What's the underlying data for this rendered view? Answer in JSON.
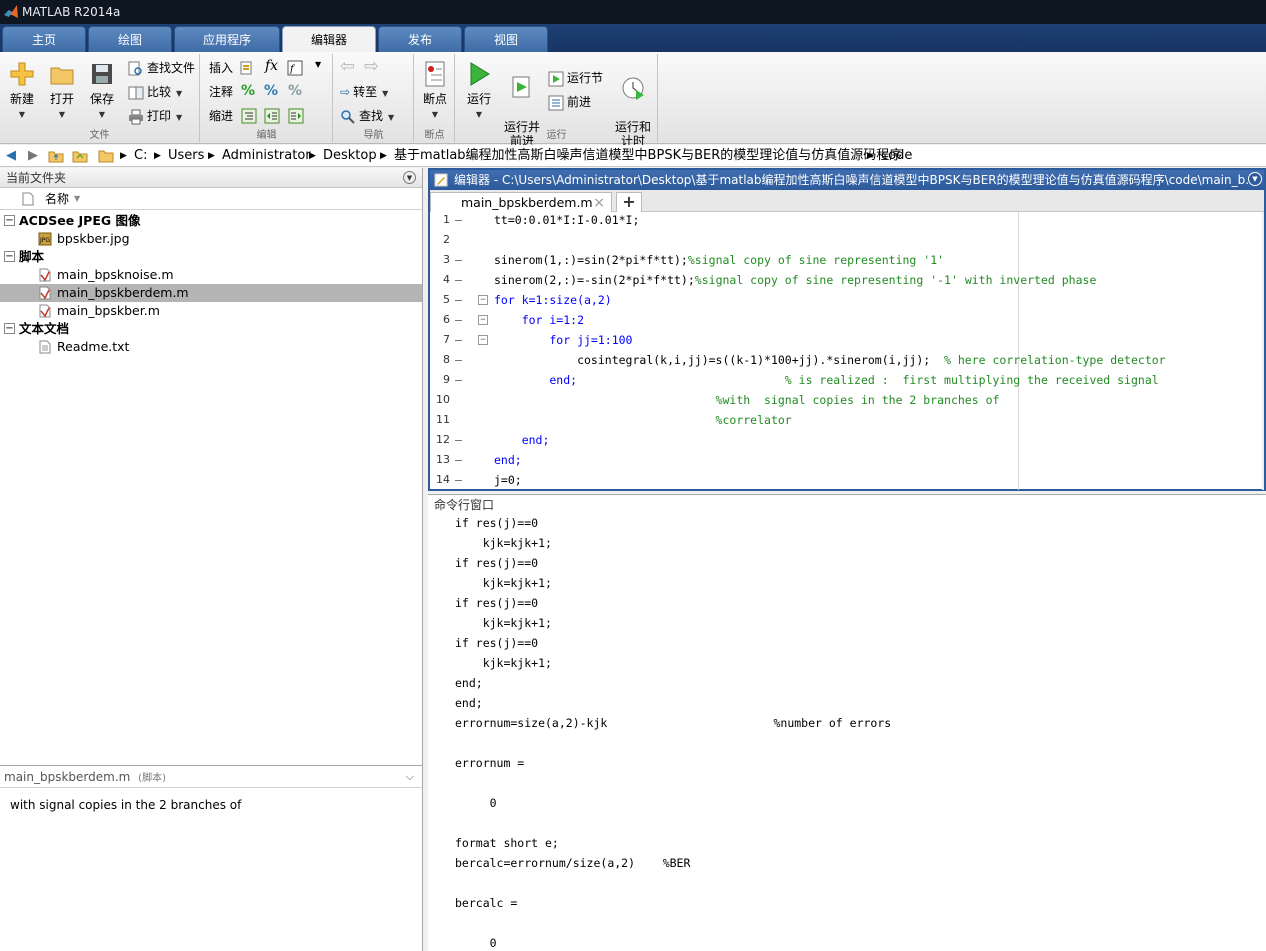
{
  "window": {
    "title": "MATLAB R2014a"
  },
  "tabs": [
    {
      "label": "主页"
    },
    {
      "label": "绘图"
    },
    {
      "label": "应用程序"
    },
    {
      "label": "编辑器"
    },
    {
      "label": "发布"
    },
    {
      "label": "视图"
    }
  ],
  "ribbon": {
    "file": {
      "group_label": "文件",
      "new_label": "新建",
      "open_label": "打开",
      "save_label": "保存",
      "find_files_label": "查找文件",
      "compare_label": "比较",
      "print_label": "打印"
    },
    "edit": {
      "group_label": "编辑",
      "insert_label": "插入",
      "comment_label": "注释",
      "indent_label": "缩进"
    },
    "navigate": {
      "group_label": "导航",
      "goto_label": "转至",
      "find_label": "查找"
    },
    "breakpoints": {
      "group_label": "断点",
      "breakpoints_label": "断点"
    },
    "run": {
      "group_label": "运行",
      "run_label": "运行",
      "run_advance_label": "运行并\n前进",
      "run_section_label": "运行节",
      "advance_label": "前进",
      "run_time_label": "运行和\n计时"
    }
  },
  "address": {
    "crumbs": [
      "C:",
      "Users",
      "Administrator",
      "Desktop",
      "基于matlab编程加性高斯白噪声信道模型中BPSK与BER的模型理论值与仿真值源码程序",
      "code"
    ]
  },
  "current_folder": {
    "title": "当前文件夹",
    "name_column": "名称",
    "groups": [
      {
        "label": "ACDSee JPEG 图像",
        "items": [
          "bpskber.jpg"
        ]
      },
      {
        "label": "脚本",
        "items": [
          "main_bpsknoise.m",
          "main_bpskberdem.m",
          "main_bpskber.m"
        ]
      },
      {
        "label": "文本文档",
        "items": [
          "Readme.txt"
        ]
      }
    ],
    "selected": "main_bpskberdem.m"
  },
  "details": {
    "file_name": "main_bpskberdem.m",
    "file_type": "(脚本)",
    "description": "with  signal copies in the 2 branches of"
  },
  "editor": {
    "title": "编辑器 - C:\\Users\\Administrator\\Desktop\\基于matlab编程加性高斯白噪声信道模型中BPSK与BER的模型理论值与仿真值源码程序\\code\\main_b...",
    "tab_label": "main_bpskberdem.m",
    "lines": [
      {
        "n": "1",
        "dash": "–",
        "code": "tt=0:0.01*I:I-0.01*I;"
      },
      {
        "n": "2",
        "dash": "",
        "code": ""
      },
      {
        "n": "3",
        "dash": "–",
        "code": "sinerom(1,:)=sin(2*pi*f*tt);",
        "comment": "%signal copy of sine representing '1'"
      },
      {
        "n": "4",
        "dash": "–",
        "code": "sinerom(2,:)=-sin(2*pi*f*tt);",
        "comment": "%signal copy of sine representing '-1' with inverted phase"
      },
      {
        "n": "5",
        "dash": "–",
        "code": "for k=1:size(a,2)"
      },
      {
        "n": "6",
        "dash": "–",
        "code": "    for i=1:2"
      },
      {
        "n": "7",
        "dash": "–",
        "code": "        for jj=1:100"
      },
      {
        "n": "8",
        "dash": "–",
        "code": "            cosintegral(k,i,jj)=s((k-1)*100+jj).*sinerom(i,jj);",
        "comment": "  % here correlation-type detector"
      },
      {
        "n": "9",
        "dash": "–",
        "code": "        end;",
        "comment": "                              % is realized :  first multiplying the received signal"
      },
      {
        "n": "10",
        "dash": "",
        "code": "",
        "comment": "                                %with  signal copies in the 2 branches of"
      },
      {
        "n": "11",
        "dash": "",
        "code": "",
        "comment": "                                %correlator"
      },
      {
        "n": "12",
        "dash": "–",
        "code": "    end;"
      },
      {
        "n": "13",
        "dash": "–",
        "code": "end;"
      },
      {
        "n": "14",
        "dash": "–",
        "code": "j=0;"
      }
    ]
  },
  "command_window": {
    "title": "命令行窗口",
    "lines": [
      "if res(j)==0",
      "    kjk=kjk+1;",
      "if res(j)==0",
      "    kjk=kjk+1;",
      "if res(j)==0",
      "    kjk=kjk+1;",
      "if res(j)==0",
      "    kjk=kjk+1;",
      "end;",
      "end;",
      "errornum=size(a,2)-kjk                        %number of errors",
      "",
      "errornum =",
      "",
      "     0",
      "",
      "format short e;",
      "bercalc=errornum/size(a,2)    %BER",
      "",
      "bercalc =",
      "",
      "     0"
    ]
  }
}
